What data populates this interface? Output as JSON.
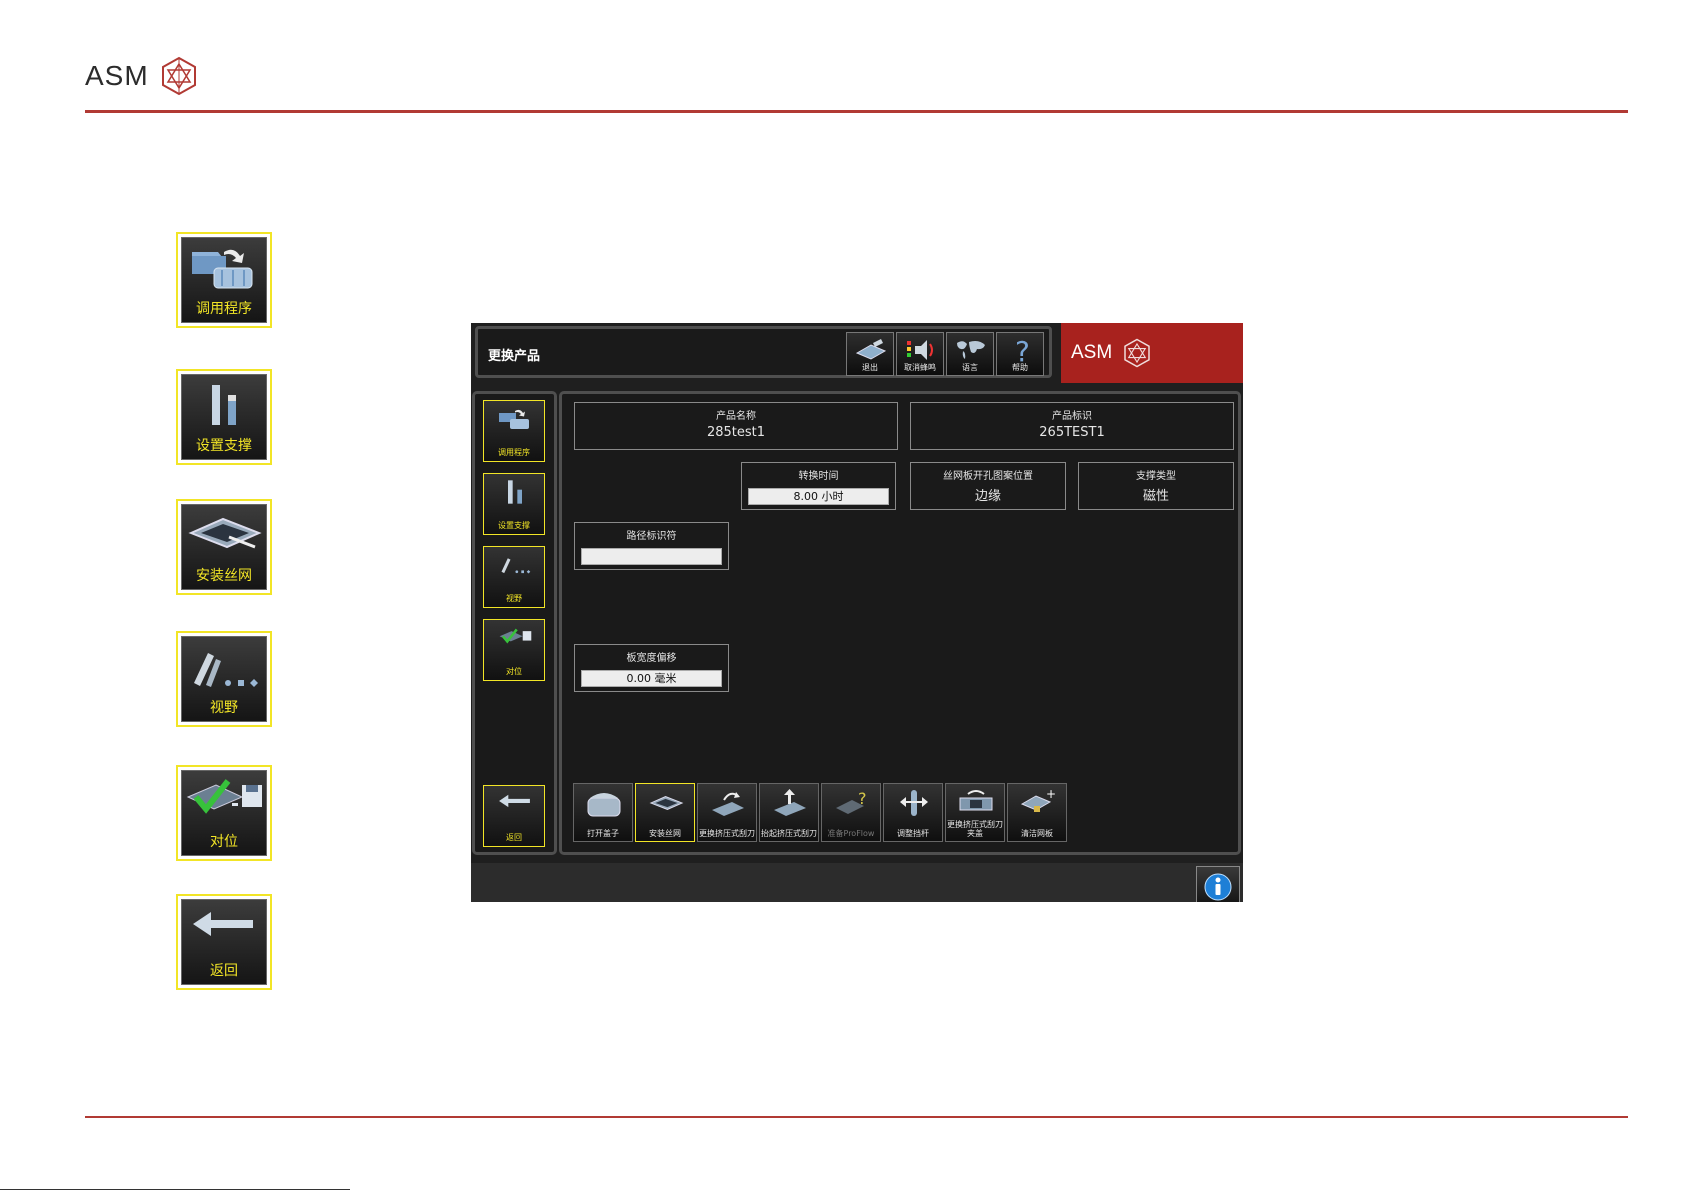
{
  "slide": {
    "logo_text": "ASM"
  },
  "legend": [
    {
      "label": "调用程序",
      "icon": "load-program-icon"
    },
    {
      "label": "设置支撑",
      "icon": "support-icon"
    },
    {
      "label": "安装丝网",
      "icon": "stencil-icon"
    },
    {
      "label": "视野",
      "icon": "vision-icon"
    },
    {
      "label": "对位",
      "icon": "alignment-icon"
    },
    {
      "label": "返回",
      "icon": "back-arrow-icon"
    }
  ],
  "screen": {
    "title": "更换产品",
    "brand_text": "ASM",
    "toolbar": [
      {
        "label": "退出",
        "icon": "exit-icon"
      },
      {
        "label": "取消蜂鸣",
        "icon": "mute-beep-icon"
      },
      {
        "label": "语言",
        "icon": "world-map-icon"
      },
      {
        "label": "帮助",
        "icon": "help-icon"
      }
    ],
    "left_buttons": [
      {
        "label": "调用程序"
      },
      {
        "label": "设置支撑"
      },
      {
        "label": "视野"
      },
      {
        "label": "对位"
      },
      {
        "label": "返回"
      }
    ],
    "fields": {
      "product_name": {
        "label": "产品名称",
        "value": "285test1"
      },
      "product_id": {
        "label": "产品标识",
        "value": "265TEST1"
      },
      "changeover_time": {
        "label": "转换时间",
        "value": "8.00 小时"
      },
      "stencil_position": {
        "label": "丝网板开孔图案位置",
        "value": "边缘"
      },
      "support_type": {
        "label": "支撑类型",
        "value": "磁性"
      },
      "route_id": {
        "label": "路径标识符",
        "value": ""
      },
      "board_width_offset": {
        "label": "板宽度偏移",
        "value": "0.00 毫米"
      }
    },
    "bottom_buttons": [
      {
        "label": "打开盖子"
      },
      {
        "label": "安装丝网"
      },
      {
        "label": "更换挤压式刮刀"
      },
      {
        "label": "抬起挤压式刮刀"
      },
      {
        "label": "准备ProFlow"
      },
      {
        "label": "调整挡杆"
      },
      {
        "label": "更换挤压式刮刀夹盖"
      },
      {
        "label": "清洁网板"
      }
    ]
  },
  "colors": {
    "accent_yellow": "#f2e526",
    "brand_red": "#a8221e",
    "slide_rule": "#b13a34"
  }
}
